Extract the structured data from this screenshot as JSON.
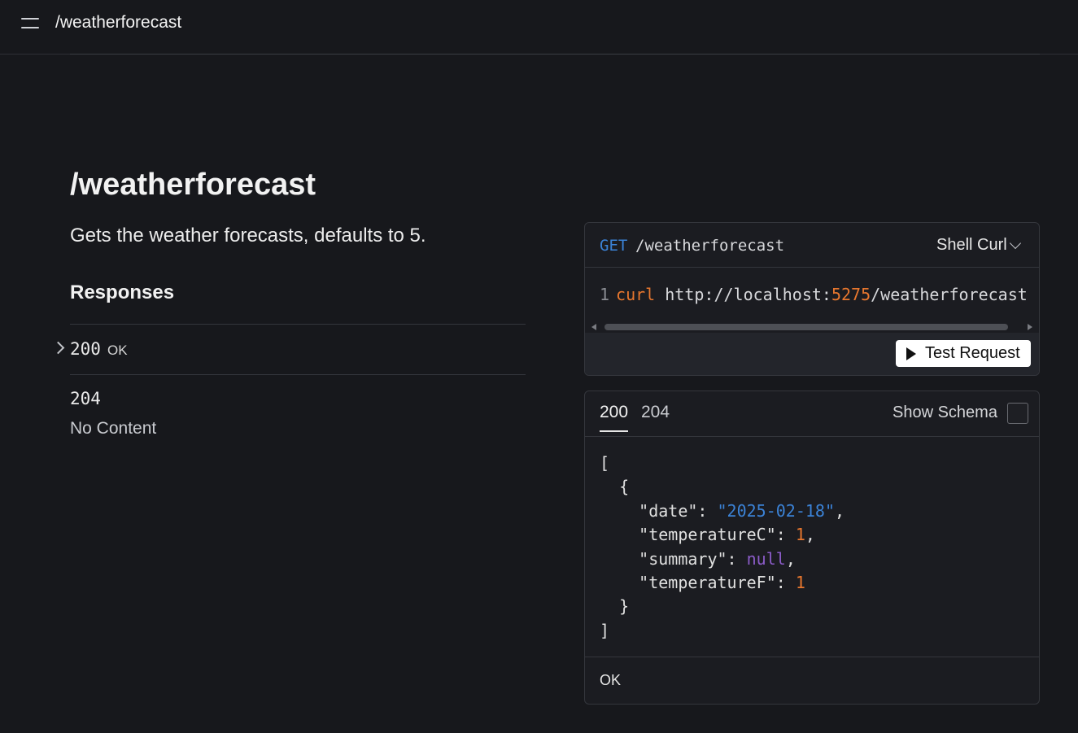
{
  "header": {
    "title": "/weatherforecast"
  },
  "main": {
    "title": "/weatherforecast",
    "description": "Gets the weather forecasts, defaults to 5.",
    "responses_heading": "Responses",
    "responses": [
      {
        "code": "200",
        "label": "OK"
      },
      {
        "code": "204",
        "label": "No Content"
      }
    ]
  },
  "request": {
    "method": "GET",
    "path": "/weatherforecast",
    "language": "Shell Curl",
    "code": {
      "line_number": "1",
      "command": "curl",
      "url_prefix": "http://localhost:",
      "port": "5275",
      "url_suffix": "/weatherforecast"
    },
    "test_button": "Test Request"
  },
  "response_example": {
    "tabs": [
      "200",
      "204"
    ],
    "show_schema_label": "Show Schema",
    "show_schema_checked": false,
    "json": {
      "open_bracket": "[",
      "open_brace": "{",
      "date_key": "\"date\"",
      "date_value": "\"2025-02-18\"",
      "tempc_key": "\"temperatureC\"",
      "tempc_value": "1",
      "summary_key": "\"summary\"",
      "summary_value": "null",
      "tempf_key": "\"temperatureF\"",
      "tempf_value": "1",
      "close_brace": "}",
      "close_bracket": "]"
    },
    "status_text": "OK"
  },
  "colors": {
    "background": "#17181c",
    "method_blue": "#3b82d6",
    "accent_orange": "#e8772e",
    "null_purple": "#8b5cc8"
  },
  "icons": [
    "menu-icon",
    "chevron-right-icon",
    "chevron-down-icon",
    "play-icon"
  ]
}
